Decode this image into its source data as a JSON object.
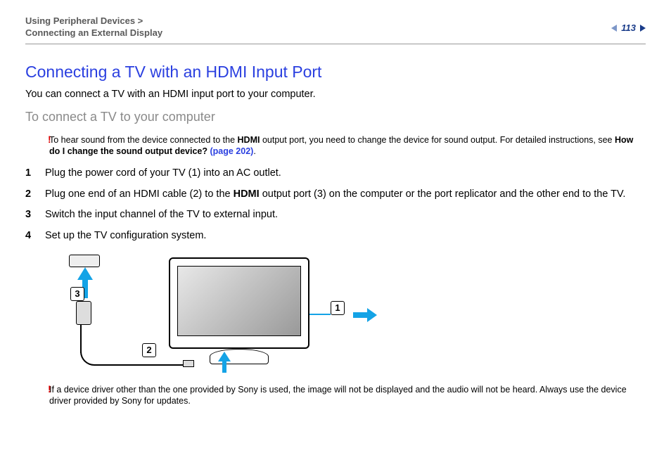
{
  "header": {
    "breadcrumb_line1": "Using Peripheral Devices >",
    "breadcrumb_line2": "Connecting an External Display",
    "page_number": "113"
  },
  "title": "Connecting a TV with an HDMI Input Port",
  "intro": "You can connect a TV with an HDMI input port to your computer.",
  "subhead": "To connect a TV to your computer",
  "note1": {
    "pre": "To hear sound from the device connected to the ",
    "b1": "HDMI",
    "mid": " output port, you need to change the device for sound output. For detailed instructions, see ",
    "b2": "How do I change the sound output device? ",
    "link": "(page 202)",
    "post": "."
  },
  "steps": {
    "s1": "Plug the power cord of your TV (1) into an AC outlet.",
    "s2_a": "Plug one end of an HDMI cable (2) to the ",
    "s2_b": "HDMI",
    "s2_c": " output port (3) on the computer or the port replicator and the other end to the TV.",
    "s3": "Switch the input channel of the TV to external input.",
    "s4": "Set up the TV configuration system."
  },
  "callouts": {
    "c1": "1",
    "c2": "2",
    "c3": "3"
  },
  "note2": "If a device driver other than the one provided by Sony is used, the image will not be displayed and the audio will not be heard. Always use the device driver provided by Sony for updates."
}
